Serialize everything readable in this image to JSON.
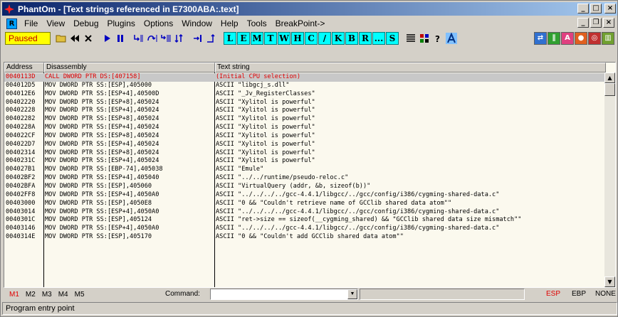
{
  "window": {
    "title": "PhantOm - [Text strings referenced in E7300ABA:.text]",
    "controls": {
      "minimize": "_",
      "maximize": "□",
      "close": "×"
    },
    "mdi_controls": {
      "minimize": "_",
      "restore": "❐",
      "close": "×"
    }
  },
  "menu": {
    "icon_letter": "R",
    "items": [
      "File",
      "View",
      "Debug",
      "Plugins",
      "Options",
      "Window",
      "Help",
      "Tools",
      "BreakPoint->"
    ]
  },
  "toolbar": {
    "status": "Paused",
    "letter_buttons": [
      "L",
      "E",
      "M",
      "T",
      "W",
      "H",
      "C",
      "/",
      "K",
      "B",
      "R",
      "...",
      "S"
    ]
  },
  "columns": {
    "address": "Address",
    "disassembly": "Disassembly",
    "text_string": "Text string"
  },
  "rows": [
    {
      "addr": "0040113D",
      "dis": "CALL DWORD PTR DS:[407158]",
      "txt": "(Initial CPU selection)",
      "selected": true
    },
    {
      "addr": "004012D5",
      "dis": "MOV DWORD PTR SS:[ESP],405000",
      "txt": "ASCII \"libgcj_s.dll\""
    },
    {
      "addr": "004012E6",
      "dis": "MOV DWORD PTR SS:[ESP+4],40500D",
      "txt": "ASCII \"_Jv_RegisterClasses\""
    },
    {
      "addr": "00402220",
      "dis": "MOV DWORD PTR SS:[ESP+8],405024",
      "txt": "ASCII \"Xylitol is powerful\""
    },
    {
      "addr": "00402228",
      "dis": "MOV DWORD PTR SS:[ESP+4],405024",
      "txt": "ASCII \"Xylitol is powerful\""
    },
    {
      "addr": "00402282",
      "dis": "MOV DWORD PTR SS:[ESP+8],405024",
      "txt": "ASCII \"Xylitol is powerful\""
    },
    {
      "addr": "0040228A",
      "dis": "MOV DWORD PTR SS:[ESP+4],405024",
      "txt": "ASCII \"Xylitol is powerful\""
    },
    {
      "addr": "004022CF",
      "dis": "MOV DWORD PTR SS:[ESP+8],405024",
      "txt": "ASCII \"Xylitol is powerful\""
    },
    {
      "addr": "004022D7",
      "dis": "MOV DWORD PTR SS:[ESP+4],405024",
      "txt": "ASCII \"Xylitol is powerful\""
    },
    {
      "addr": "00402314",
      "dis": "MOV DWORD PTR SS:[ESP+8],405024",
      "txt": "ASCII \"Xylitol is powerful\""
    },
    {
      "addr": "0040231C",
      "dis": "MOV DWORD PTR SS:[ESP+4],405024",
      "txt": "ASCII \"Xylitol is powerful\""
    },
    {
      "addr": "004027B1",
      "dis": "MOV DWORD PTR SS:[EBP-74],405038",
      "txt": "ASCII \"Emule\""
    },
    {
      "addr": "00402BF2",
      "dis": "MOV DWORD PTR SS:[ESP+4],405040",
      "txt": "ASCII \"../../runtime/pseudo-reloc.c\""
    },
    {
      "addr": "00402BFA",
      "dis": "MOV DWORD PTR SS:[ESP],405060",
      "txt": "ASCII \"VirtualQuery (addr, &b, sizeof(b))\""
    },
    {
      "addr": "00402FF8",
      "dis": "MOV DWORD PTR SS:[ESP+4],4050A0",
      "txt": "ASCII \"../../../../gcc-4.4.1/libgcc/../gcc/config/i386/cygming-shared-data.c\""
    },
    {
      "addr": "00403000",
      "dis": "MOV DWORD PTR SS:[ESP],4050E8",
      "txt": "ASCII \"0 && \"Couldn't retrieve name of GCClib shared data atom\"\""
    },
    {
      "addr": "00403014",
      "dis": "MOV DWORD PTR SS:[ESP+4],4050A0",
      "txt": "ASCII \"../../../../gcc-4.4.1/libgcc/../gcc/config/i386/cygming-shared-data.c\""
    },
    {
      "addr": "0040301C",
      "dis": "MOV DWORD PTR SS:[ESP],405124",
      "txt": "ASCII \"ret->size == sizeof(__cygming_shared) && \"GCClib shared data size mismatch\"\""
    },
    {
      "addr": "00403146",
      "dis": "MOV DWORD PTR SS:[ESP+4],4050A0",
      "txt": "ASCII \"../../../../gcc-4.4.1/libgcc/../gcc/config/i386/cygming-shared-data.c\""
    },
    {
      "addr": "0040314E",
      "dis": "MOV DWORD PTR SS:[ESP],405170",
      "txt": "ASCII \"0 && \"Couldn't add GCClib shared data atom\"\""
    }
  ],
  "command_bar": {
    "tabs": [
      "M1",
      "M2",
      "M3",
      "M4",
      "M5"
    ],
    "active_tab": "M1",
    "command_label": "Command:",
    "registers": [
      "ESP",
      "EBP",
      "NONE"
    ],
    "active_register": "ESP"
  },
  "statusbar": {
    "text": "Program entry point"
  },
  "colors": {
    "title_start": "#0a246a",
    "title_end": "#a6caf0",
    "pane_bg": "#fbf9ee",
    "selected_text": "#e00000",
    "paused_bg": "#ffff00",
    "letter_bg": "#00ffff"
  }
}
